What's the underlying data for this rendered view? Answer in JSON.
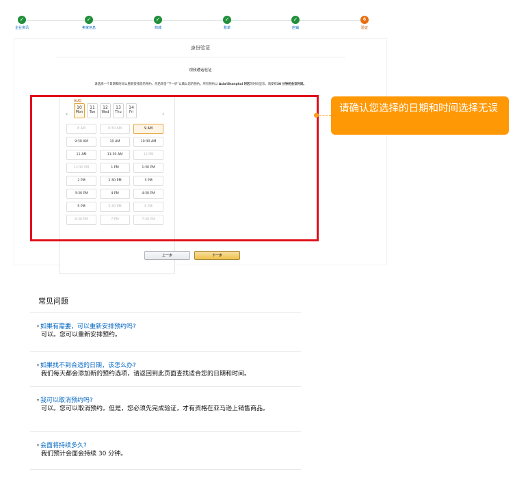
{
  "stepper": {
    "steps": [
      {
        "label": "企业资讯",
        "icon": "checkmark-icon",
        "glyph": "✓"
      },
      {
        "label": "卖家信息",
        "icon": "checkmark-icon",
        "glyph": "✓"
      },
      {
        "label": "商城",
        "icon": "checkmark-icon",
        "glyph": "✓"
      },
      {
        "label": "账单",
        "icon": "checkmark-icon",
        "glyph": "✓"
      },
      {
        "label": "店铺",
        "icon": "checkmark-icon",
        "glyph": "✓"
      },
      {
        "label": "验证",
        "number": "6"
      }
    ],
    "colors": {
      "done": "#1f8f3a",
      "current": "#e96e10"
    }
  },
  "card": {
    "title": "身份验证",
    "section_title": "视频通话验证",
    "instructions_pre": "请选择一个日期和时间以重新安排您的预约，然后单击“下一步”以确认您的预约。所有预约以 ",
    "instructions_tz": "Asia/Shanghai 时区",
    "instructions_mid": "的时间显示。请安排",
    "instructions_bold": "30 分钟的会议时间。"
  },
  "scheduler": {
    "month": "AUG",
    "prev_arrow": "‹",
    "next_arrow": "›",
    "dates": [
      {
        "day": "10",
        "weekday": "Mon",
        "selected": true
      },
      {
        "day": "11",
        "weekday": "Tue",
        "selected": false
      },
      {
        "day": "12",
        "weekday": "Wed",
        "selected": false
      },
      {
        "day": "13",
        "weekday": "Thu",
        "selected": false
      },
      {
        "day": "14",
        "weekday": "Fri",
        "selected": false
      }
    ],
    "times": [
      {
        "label": "8 AM",
        "state": "disabled"
      },
      {
        "label": "8:30 AM",
        "state": "disabled"
      },
      {
        "label": "9 AM",
        "state": "selected"
      },
      {
        "label": "9:30 AM",
        "state": "available"
      },
      {
        "label": "10 AM",
        "state": "available"
      },
      {
        "label": "10:30 AM",
        "state": "available"
      },
      {
        "label": "11 AM",
        "state": "available"
      },
      {
        "label": "11:30 AM",
        "state": "available"
      },
      {
        "label": "12 PM",
        "state": "disabled"
      },
      {
        "label": "12:30 PM",
        "state": "disabled"
      },
      {
        "label": "1 PM",
        "state": "available"
      },
      {
        "label": "1:30 PM",
        "state": "available"
      },
      {
        "label": "2 PM",
        "state": "available"
      },
      {
        "label": "2:30 PM",
        "state": "available"
      },
      {
        "label": "3 PM",
        "state": "available"
      },
      {
        "label": "3:30 PM",
        "state": "available"
      },
      {
        "label": "4 PM",
        "state": "available"
      },
      {
        "label": "4:30 PM",
        "state": "available"
      },
      {
        "label": "5 PM",
        "state": "available"
      },
      {
        "label": "5:30 PM",
        "state": "disabled"
      },
      {
        "label": "6 PM",
        "state": "disabled"
      },
      {
        "label": "6:30 PM",
        "state": "disabled"
      },
      {
        "label": "7 PM",
        "state": "disabled"
      },
      {
        "label": "7:30 PM",
        "state": "disabled"
      }
    ]
  },
  "buttons": {
    "prev_label": "上一步",
    "next_label": "下一步"
  },
  "annotation": {
    "callout_text": "请确认您选择的日期和时间选择无误",
    "highlight_color": "#e0101a",
    "callout_color": "#ff9805"
  },
  "faq": {
    "title": "常见问题",
    "caret": "▾",
    "items": [
      {
        "q": "如果有需要，可以重新安排预约吗?",
        "a": "可以。您可以重新安排预约。"
      },
      {
        "q": "如果找不到合适的日期，该怎么办?",
        "a": "我们每天都会添加新的预约选项，请返回到此页面查找适合您的日期和时间。"
      },
      {
        "q": "我可以取消预约吗?",
        "a": "可以。您可以取消预约。但是，您必须先完成验证，才有资格在亚马逊上销售商品。"
      },
      {
        "q": "会面将持续多久?",
        "a": "我们预计会面会持续 30 分钟。"
      }
    ]
  }
}
